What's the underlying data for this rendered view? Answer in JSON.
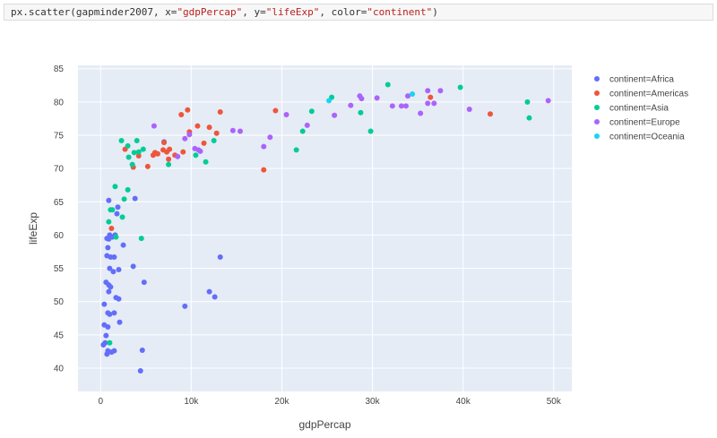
{
  "code_cell": {
    "tokens": [
      {
        "text": "px.scatter(gapminder2007, x=",
        "kind": "default"
      },
      {
        "text": "\"gdpPercap\"",
        "kind": "str"
      },
      {
        "text": ", y=",
        "kind": "default"
      },
      {
        "text": "\"lifeExp\"",
        "kind": "str"
      },
      {
        "text": ", color=",
        "kind": "default"
      },
      {
        "text": "\"continent\"",
        "kind": "str"
      },
      {
        "text": ")",
        "kind": "default"
      }
    ]
  },
  "chart_data": {
    "type": "scatter",
    "title": "",
    "xlabel": "gdpPercap",
    "ylabel": "lifeExp",
    "xlim": [
      -2500,
      52000
    ],
    "ylim": [
      36.5,
      85.5
    ],
    "x_ticks": [
      0,
      10000,
      20000,
      30000,
      40000,
      50000
    ],
    "x_tick_labels": [
      "0",
      "10k",
      "20k",
      "30k",
      "40k",
      "50k"
    ],
    "y_ticks": [
      40,
      45,
      50,
      55,
      60,
      65,
      70,
      75,
      80,
      85
    ],
    "y_tick_labels": [
      "40",
      "45",
      "50",
      "55",
      "60",
      "65",
      "70",
      "75",
      "80",
      "85"
    ],
    "grid": true,
    "plot_background": "#e5ecf6",
    "legend_position": "right",
    "series": [
      {
        "name": "continent=Africa",
        "color": "#636efa",
        "points": [
          [
            300,
            43.5
          ],
          [
            400,
            46.5
          ],
          [
            400,
            49.6
          ],
          [
            500,
            43.8
          ],
          [
            600,
            52.9
          ],
          [
            600,
            44.9
          ],
          [
            700,
            42.1
          ],
          [
            700,
            56.9
          ],
          [
            700,
            59.5
          ],
          [
            800,
            42.6
          ],
          [
            800,
            46.2
          ],
          [
            800,
            48.3
          ],
          [
            800,
            58.1
          ],
          [
            900,
            51.5
          ],
          [
            900,
            52.5
          ],
          [
            900,
            59.4
          ],
          [
            900,
            65.2
          ],
          [
            1000,
            48.1
          ],
          [
            1000,
            55.0
          ],
          [
            1000,
            60.0
          ],
          [
            1100,
            52.2
          ],
          [
            1100,
            56.7
          ],
          [
            1200,
            42.4
          ],
          [
            1300,
            59.7
          ],
          [
            1400,
            54.5
          ],
          [
            1500,
            42.6
          ],
          [
            1500,
            48.3
          ],
          [
            1500,
            56.7
          ],
          [
            1600,
            60.0
          ],
          [
            1700,
            50.6
          ],
          [
            1800,
            63.2
          ],
          [
            1900,
            64.2
          ],
          [
            2000,
            50.4
          ],
          [
            2000,
            54.8
          ],
          [
            2100,
            46.9
          ],
          [
            2500,
            58.5
          ],
          [
            3600,
            55.3
          ],
          [
            3800,
            65.5
          ],
          [
            4400,
            39.6
          ],
          [
            4600,
            42.7
          ],
          [
            4800,
            52.9
          ],
          [
            7000,
            74.0
          ],
          [
            9300,
            49.3
          ],
          [
            12000,
            51.5
          ],
          [
            12600,
            50.7
          ],
          [
            13200,
            56.7
          ]
        ]
      },
      {
        "name": "continent=Americas",
        "color": "#ef553b",
        "points": [
          [
            1200,
            61.0
          ],
          [
            2700,
            72.9
          ],
          [
            3600,
            70.2
          ],
          [
            4200,
            71.9
          ],
          [
            5200,
            70.3
          ],
          [
            5800,
            72.0
          ],
          [
            6000,
            72.4
          ],
          [
            6300,
            72.2
          ],
          [
            6900,
            72.8
          ],
          [
            7000,
            73.9
          ],
          [
            7300,
            72.5
          ],
          [
            7500,
            71.4
          ],
          [
            7600,
            72.9
          ],
          [
            8200,
            72.0
          ],
          [
            8900,
            78.1
          ],
          [
            9100,
            72.5
          ],
          [
            9600,
            78.8
          ],
          [
            9800,
            75.5
          ],
          [
            10700,
            76.4
          ],
          [
            11400,
            73.8
          ],
          [
            12000,
            76.2
          ],
          [
            12800,
            75.3
          ],
          [
            13200,
            78.5
          ],
          [
            18000,
            69.8
          ],
          [
            19300,
            78.7
          ],
          [
            36400,
            80.7
          ],
          [
            43000,
            78.2
          ]
        ]
      },
      {
        "name": "continent=Asia",
        "color": "#00cc96",
        "points": [
          [
            900,
            62.0
          ],
          [
            1000,
            43.8
          ],
          [
            1100,
            63.8
          ],
          [
            1300,
            63.8
          ],
          [
            1600,
            67.3
          ],
          [
            1700,
            59.7
          ],
          [
            2300,
            74.2
          ],
          [
            2400,
            62.7
          ],
          [
            2600,
            65.4
          ],
          [
            3000,
            73.4
          ],
          [
            3100,
            71.7
          ],
          [
            3500,
            70.6
          ],
          [
            3700,
            72.4
          ],
          [
            4000,
            74.2
          ],
          [
            4200,
            72.5
          ],
          [
            4500,
            59.5
          ],
          [
            4700,
            72.9
          ],
          [
            7500,
            70.6
          ],
          [
            10500,
            72.0
          ],
          [
            11600,
            71.0
          ],
          [
            12500,
            74.2
          ],
          [
            21600,
            72.8
          ],
          [
            22300,
            75.6
          ],
          [
            23300,
            78.6
          ],
          [
            25500,
            80.7
          ],
          [
            28700,
            78.4
          ],
          [
            29800,
            75.6
          ],
          [
            31700,
            82.6
          ],
          [
            39700,
            82.2
          ],
          [
            47100,
            80.0
          ],
          [
            47300,
            77.6
          ],
          [
            3000,
            66.8
          ]
        ]
      },
      {
        "name": "continent=Europe",
        "color": "#ab63fa",
        "points": [
          [
            5900,
            76.4
          ],
          [
            8500,
            71.8
          ],
          [
            9300,
            74.5
          ],
          [
            9800,
            75.1
          ],
          [
            10400,
            73.0
          ],
          [
            10800,
            72.8
          ],
          [
            11000,
            72.6
          ],
          [
            14600,
            75.7
          ],
          [
            15400,
            75.6
          ],
          [
            18000,
            73.3
          ],
          [
            18700,
            74.7
          ],
          [
            20500,
            78.1
          ],
          [
            22800,
            76.5
          ],
          [
            25800,
            78.0
          ],
          [
            27600,
            79.5
          ],
          [
            28600,
            80.9
          ],
          [
            28800,
            80.5
          ],
          [
            30500,
            80.6
          ],
          [
            32200,
            79.4
          ],
          [
            33200,
            79.4
          ],
          [
            33700,
            79.4
          ],
          [
            33900,
            80.9
          ],
          [
            35300,
            78.3
          ],
          [
            36100,
            79.8
          ],
          [
            36100,
            81.7
          ],
          [
            36800,
            79.8
          ],
          [
            37500,
            81.7
          ],
          [
            40700,
            78.9
          ],
          [
            49400,
            80.2
          ]
        ]
      },
      {
        "name": "continent=Oceania",
        "color": "#19d3f3",
        "points": [
          [
            25200,
            80.2
          ],
          [
            34400,
            81.2
          ]
        ]
      }
    ]
  }
}
